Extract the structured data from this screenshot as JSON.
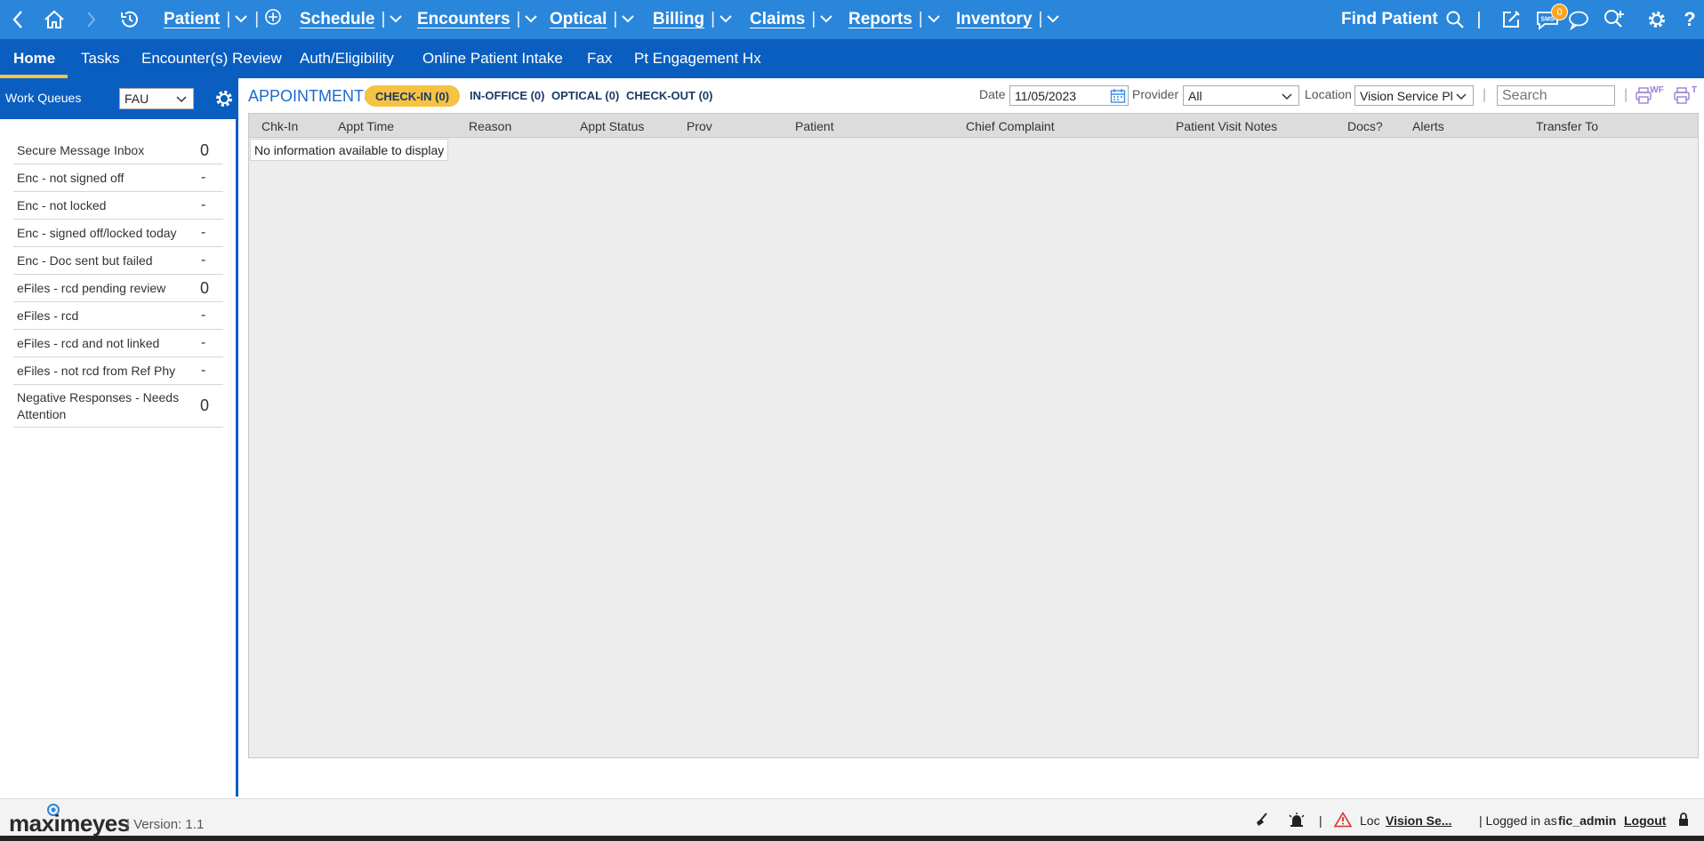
{
  "topbar": {
    "menus": [
      {
        "label": "Patient",
        "has_add": true
      },
      {
        "label": "Schedule"
      },
      {
        "label": "Encounters"
      },
      {
        "label": "Optical"
      },
      {
        "label": "Billing"
      },
      {
        "label": "Claims"
      },
      {
        "label": "Reports"
      },
      {
        "label": "Inventory"
      }
    ],
    "find_patient": "Find Patient",
    "sms_badge": "0",
    "sms_label": "SMS"
  },
  "tabs": [
    "Home",
    "Tasks",
    "Encounter(s) Review",
    "Auth/Eligibility",
    "Online Patient Intake",
    "Fax",
    "Pt Engagement Hx"
  ],
  "sidebar": {
    "title": "Work Queues",
    "selected_queue": "FAU",
    "items": [
      {
        "label": "Secure Message Inbox",
        "count": "0"
      },
      {
        "label": "Enc - not signed off",
        "count": "-"
      },
      {
        "label": "Enc - not locked",
        "count": "-"
      },
      {
        "label": "Enc - signed off/locked today",
        "count": "-"
      },
      {
        "label": "Enc - Doc sent but failed",
        "count": "-"
      },
      {
        "label": "eFiles - rcd pending review",
        "count": "0"
      },
      {
        "label": "eFiles - rcd",
        "count": "-"
      },
      {
        "label": "eFiles - rcd and not linked",
        "count": "-"
      },
      {
        "label": "eFiles - not rcd from Ref Phy",
        "count": "-"
      },
      {
        "label": "Negative Responses - Needs Attention",
        "count": "0"
      }
    ]
  },
  "appointments": {
    "title": "APPOINTMENTS",
    "status_tabs": [
      "CHECK-IN (0)",
      "IN-OFFICE (0)",
      "OPTICAL (0)",
      "CHECK-OUT (0)"
    ],
    "date_label": "Date",
    "date_value": "11/05/2023",
    "provider_label": "Provider",
    "provider_value": "All",
    "location_label": "Location",
    "location_value": "Vision Service Plan",
    "search_placeholder": "Search",
    "print_wf_label": "WF",
    "print_t_label": "T",
    "columns": [
      "Chk-In",
      "Appt Time",
      "Reason",
      "Appt Status",
      "Prov",
      "Patient",
      "Chief Complaint",
      "Patient Visit Notes",
      "Docs?",
      "Alerts",
      "Transfer To"
    ],
    "empty_message": "No information available to display"
  },
  "footer": {
    "logo_text": "maximeyes",
    "version": "| Version: 1.1",
    "loc_label": "Loc",
    "loc_value": "Vision Se...",
    "logged_in_label": "| Logged in as",
    "user": "fic_admin",
    "logout": "Logout"
  },
  "colors": {
    "topbar": "#2a86da",
    "tabbar": "#0a5ec0",
    "accent": "#f5c242",
    "badge": "#f5a623"
  }
}
